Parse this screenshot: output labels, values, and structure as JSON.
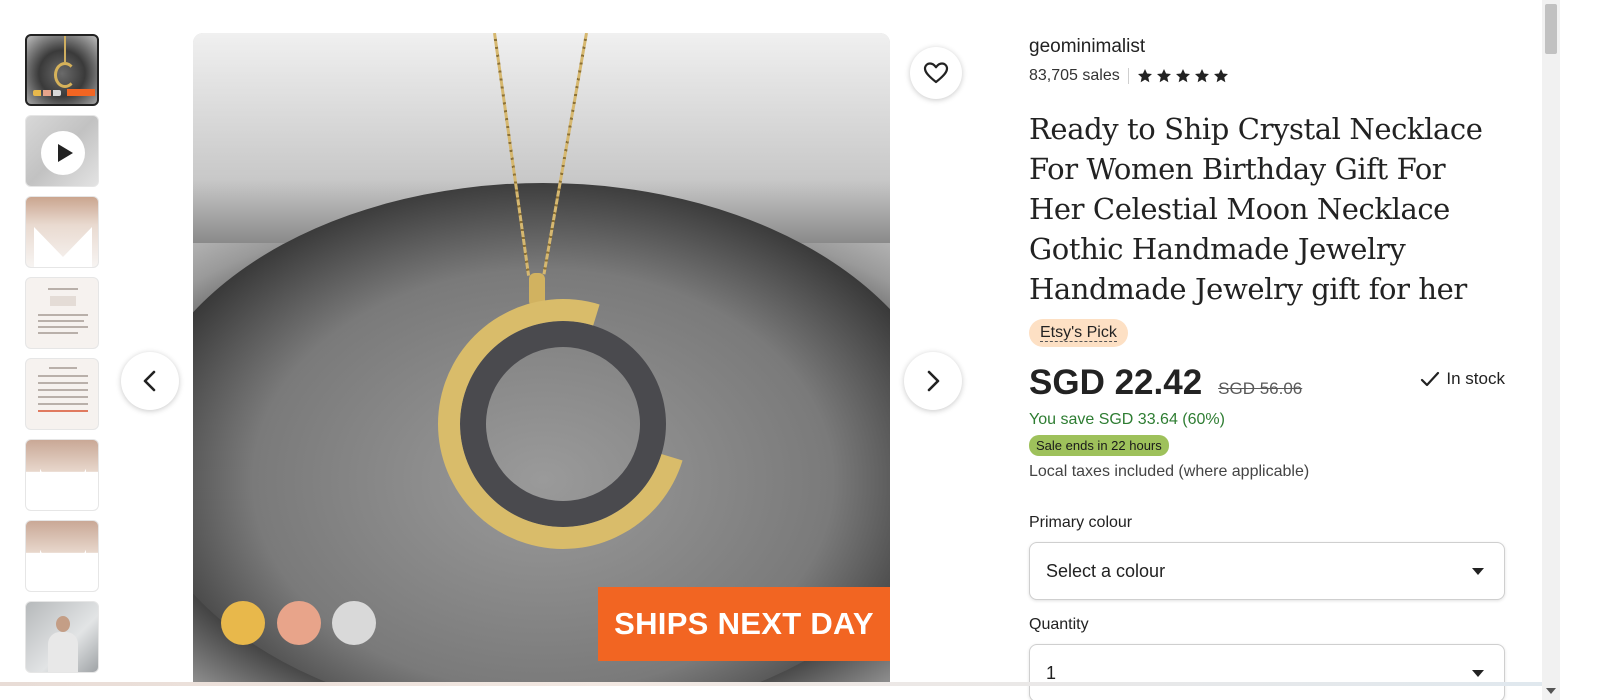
{
  "gallery": {
    "thumbnails": [
      {
        "kind": "image",
        "active": true
      },
      {
        "kind": "video"
      },
      {
        "kind": "image"
      },
      {
        "kind": "image"
      },
      {
        "kind": "image"
      },
      {
        "kind": "image"
      },
      {
        "kind": "image"
      },
      {
        "kind": "image"
      }
    ],
    "badge_text": "SHIPS NEXT DAY",
    "badge_color": "#f26522",
    "swatch_colors": [
      "#e8b84b",
      "#e8a48a",
      "#d9d9d9"
    ],
    "prev_icon": "chevron-left-icon",
    "next_icon": "chevron-right-icon",
    "favorite_icon": "heart-icon"
  },
  "shop": {
    "name": "geominimalist",
    "sales": "83,705 sales",
    "rating": 5
  },
  "listing": {
    "title": "Ready to Ship Crystal Necklace For Women Birthday Gift For Her Celestial Moon Necklace Gothic Handmade Jewelry Handmade Jewelry gift for her",
    "pick_badge": "Etsy's Pick",
    "price": "SGD 22.42",
    "original_price": "SGD 56.06",
    "stock": "In stock",
    "savings": "You save SGD 33.64 (60%)",
    "sale_badge": "Sale ends in 22 hours",
    "tax_note": "Local taxes included (where applicable)"
  },
  "options": {
    "colour_label": "Primary colour",
    "colour_value": "Select a colour",
    "quantity_label": "Quantity",
    "quantity_value": "1"
  },
  "colors": {
    "save_green": "#2e7d32",
    "sale_badge_bg": "#9ec15b",
    "pick_badge_bg": "#fde0c4"
  }
}
